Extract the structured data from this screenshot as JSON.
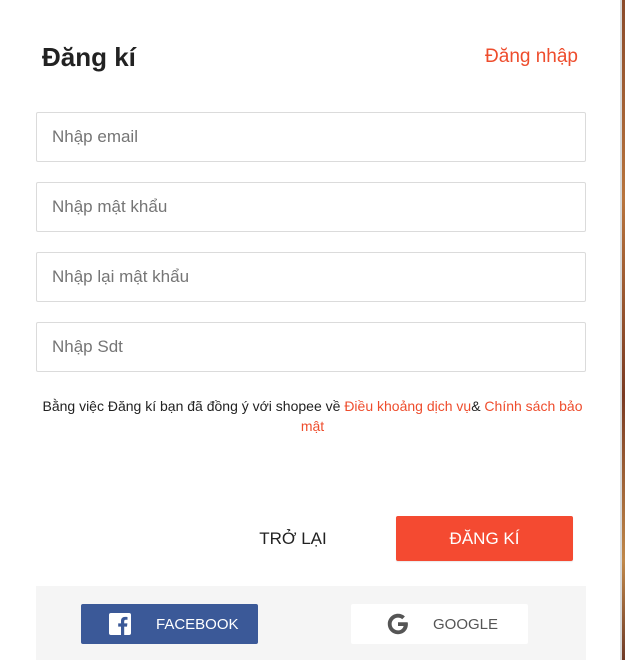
{
  "header": {
    "title": "Đăng kí",
    "login_link": "Đăng nhập"
  },
  "form": {
    "email_placeholder": "Nhập email",
    "password_placeholder": "Nhập mật khẩu",
    "confirm_password_placeholder": "Nhập lại mật khẩu",
    "phone_placeholder": "Nhập Sdt"
  },
  "terms": {
    "prefix": "Bằng việc Đăng kí bạn đã đồng ý với shopee về ",
    "terms_link": "Điều khoảng dịch vụ",
    "separator": "& ",
    "privacy_link": "Chính sách bảo mật"
  },
  "actions": {
    "back_label": "TRỞ LẠI",
    "submit_label": "ĐĂNG KÍ"
  },
  "social": {
    "facebook_label": "FACEBOOK",
    "facebook_icon": "facebook-icon",
    "google_label": "GOOGLE",
    "google_icon": "google-icon"
  },
  "colors": {
    "accent": "#ee4d2d",
    "submit_bg": "#f44a31",
    "facebook_bg": "#3b5998",
    "footer_bg": "#f5f5f5"
  }
}
